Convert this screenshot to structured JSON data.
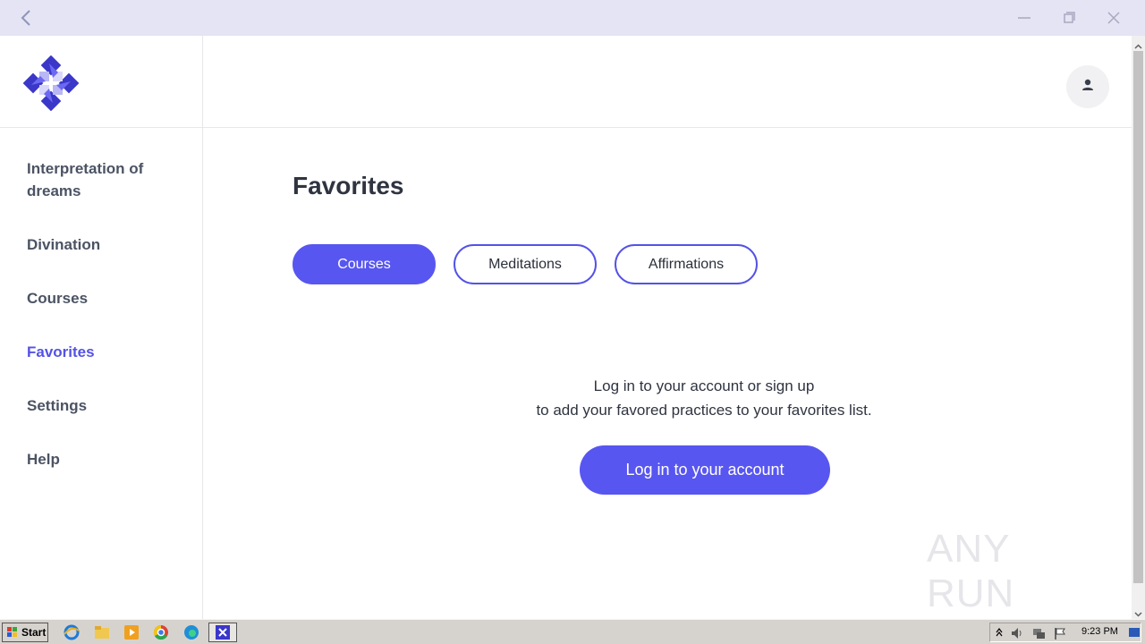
{
  "window": {
    "back_icon": "chevron-left-icon",
    "controls": [
      "minimize-icon",
      "restore-icon",
      "close-icon"
    ]
  },
  "sidebar": {
    "logo": "app-logo",
    "items": [
      {
        "label": "Interpretation of\ndreams",
        "active": false
      },
      {
        "label": "Divination",
        "active": false
      },
      {
        "label": "Courses",
        "active": false
      },
      {
        "label": "Favorites",
        "active": true
      },
      {
        "label": "Settings",
        "active": false
      },
      {
        "label": "Help",
        "active": false
      }
    ]
  },
  "header": {
    "avatar_icon": "user-icon"
  },
  "main": {
    "title": "Favorites",
    "tabs": [
      {
        "label": "Courses",
        "active": true
      },
      {
        "label": "Meditations",
        "active": false
      },
      {
        "label": "Affirmations",
        "active": false
      }
    ],
    "message_line1": "Log in to your account or sign up",
    "message_line2": "to add your favored practices to your favorites list.",
    "login_button": "Log in to your account"
  },
  "watermark": {
    "text": "ANY RUN"
  },
  "taskbar": {
    "start_label": "Start",
    "apps": [
      "ie-icon",
      "explorer-icon",
      "media-player-icon",
      "chrome-icon",
      "edge-icon",
      "app-icon"
    ],
    "clock": "9:23 PM"
  },
  "colors": {
    "accent": "#5856f0",
    "active_nav": "#5452e6",
    "nav_text": "#4b5363",
    "titlebar": "#e4e4f4"
  }
}
